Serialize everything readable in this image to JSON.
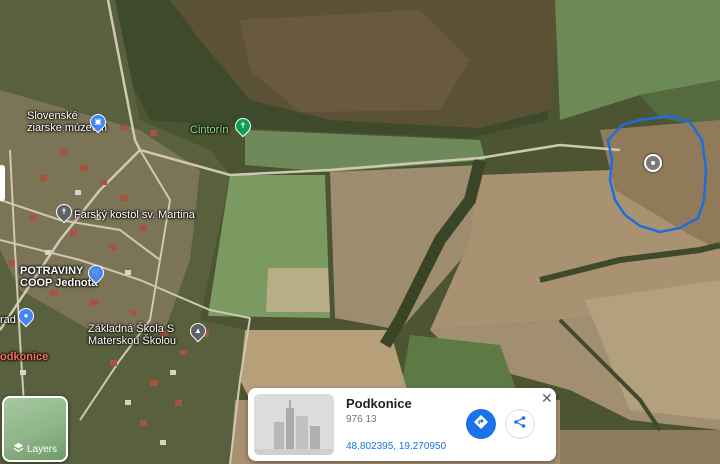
{
  "map": {
    "labels": {
      "museum_line1": "Slovenské",
      "museum_line2": "ziarske múzeum",
      "cemetery": "Cintorín",
      "church": "Farský kostol sv. Martina",
      "shop_line1": "POTRAVINY",
      "shop_line2": "COOP Jednota",
      "school_line1": "Základná Škola S",
      "school_line2": "Materskou Školou",
      "rad": "rad",
      "town": "odkonice"
    },
    "icons": {
      "museum": "museum-icon",
      "cemetery": "cemetery-icon",
      "church": "cross-icon",
      "shop": "cart-icon",
      "school": "school-icon",
      "marker": "place-marker-icon"
    }
  },
  "layers": {
    "label": "Layers"
  },
  "place_card": {
    "title": "Podkonice",
    "postal": "976 13",
    "coordinates": "48.802395, 19.270950",
    "close": "✕"
  },
  "colors": {
    "accent": "#1a73e8",
    "outline": "#1e6ddc",
    "green_poi": "#0f9d58",
    "blue_poi": "#4285f4"
  }
}
